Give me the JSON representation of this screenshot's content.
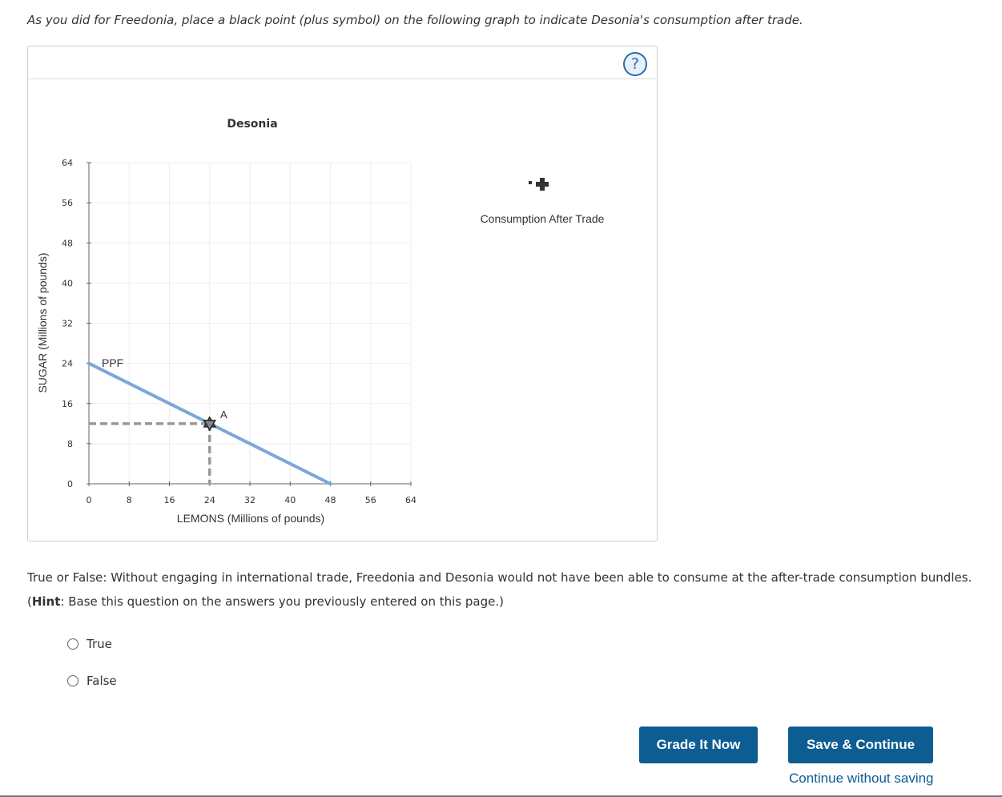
{
  "instruction": "As you did for Freedonia, place a black point (plus symbol) on the following graph to indicate Desonia's consumption after trade.",
  "help_label": "?",
  "graph": {
    "title": "Desonia",
    "xlabel": "LEMONS (Millions of pounds)",
    "ylabel": "SUGAR (Millions of pounds)",
    "tool_label": "Consumption After Trade",
    "ppf_label": "PPF",
    "point_label": "A"
  },
  "chart_data": {
    "type": "line",
    "title": "Desonia",
    "xlabel": "LEMONS (Millions of pounds)",
    "ylabel": "SUGAR (Millions of pounds)",
    "xlim": [
      0,
      64
    ],
    "ylim": [
      0,
      64
    ],
    "x_ticks": [
      0,
      8,
      16,
      24,
      32,
      40,
      48,
      56,
      64
    ],
    "y_ticks": [
      0,
      8,
      16,
      24,
      32,
      40,
      48,
      56,
      64
    ],
    "grid": true,
    "series": [
      {
        "name": "PPF",
        "x": [
          0,
          48
        ],
        "y": [
          24,
          0
        ],
        "color": "#7ba7d7"
      }
    ],
    "points": [
      {
        "name": "A",
        "x": 24,
        "y": 12,
        "marker": "star"
      }
    ],
    "guides": {
      "x": 24,
      "y": 12,
      "color": "#999999"
    }
  },
  "question": {
    "prefix": "True or False: Without engaging in international trade, Freedonia and Desonia would not have been able to consume at the after-trade consumption bundles. (",
    "hint_label": "Hint",
    "suffix": ": Base this question on the answers you previously entered on this page.)",
    "options": [
      "True",
      "False"
    ]
  },
  "buttons": {
    "grade": "Grade It Now",
    "save": "Save & Continue",
    "continue": "Continue without saving"
  },
  "colors": {
    "primary": "#0d5d93",
    "ppf": "#7ba7d7",
    "guide": "#999999"
  }
}
